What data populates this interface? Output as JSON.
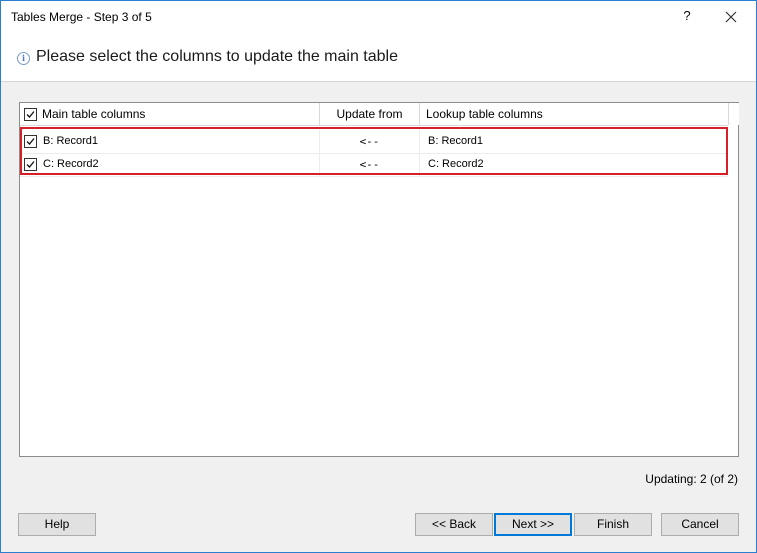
{
  "window": {
    "title": "Tables Merge - Step 3 of 5",
    "help_label": "?",
    "close_label": "✕"
  },
  "header": {
    "info_glyph": "i",
    "heading": "Please select the columns to update the main table"
  },
  "grid": {
    "columns": {
      "main": "Main table columns",
      "update": "Update from",
      "lookup": "Lookup table columns"
    },
    "header_checked": true,
    "rows": [
      {
        "checked": true,
        "main": "B: Record1",
        "update": "<--",
        "lookup": "B: Record1"
      },
      {
        "checked": true,
        "main": "C: Record2",
        "update": "<--",
        "lookup": "C: Record2"
      }
    ]
  },
  "status": {
    "text": "Updating: 2 (of 2)"
  },
  "buttons": {
    "help": "Help",
    "back": "<< Back",
    "next": "Next >>",
    "finish": "Finish",
    "cancel": "Cancel"
  },
  "colors": {
    "accent": "#0078d7",
    "highlight": "#d61f26",
    "window_border": "#2b7fd0"
  },
  "icons": {
    "info": "info-icon",
    "help": "question-icon",
    "close": "close-icon",
    "check": "checkmark-icon"
  }
}
